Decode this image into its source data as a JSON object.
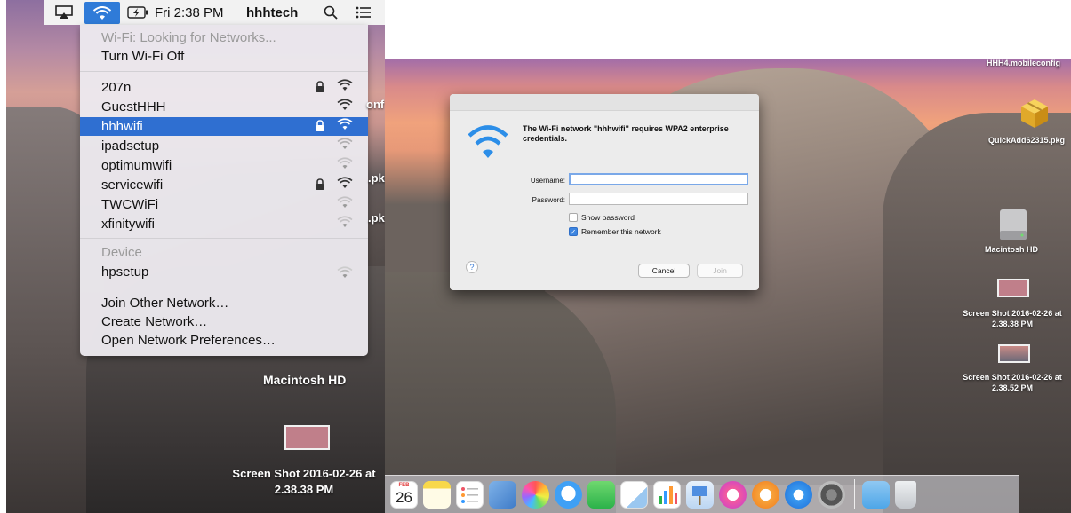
{
  "menubar": {
    "clock": "Fri 2:38 PM",
    "user": "hhhtech"
  },
  "wifi_menu": {
    "status": "Wi-Fi: Looking for Networks...",
    "toggle": "Turn Wi-Fi Off",
    "networks": [
      {
        "name": "207n",
        "locked": true,
        "selected": false
      },
      {
        "name": "GuestHHH",
        "locked": false,
        "selected": false
      },
      {
        "name": "hhhwifi",
        "locked": true,
        "selected": true
      },
      {
        "name": "ipadsetup",
        "locked": false,
        "selected": false
      },
      {
        "name": "optimumwifi",
        "locked": false,
        "selected": false
      },
      {
        "name": "servicewifi",
        "locked": true,
        "selected": false
      },
      {
        "name": "TWCWiFi",
        "locked": false,
        "selected": false
      },
      {
        "name": "xfinitywifi",
        "locked": false,
        "selected": false
      }
    ],
    "device_header": "Device",
    "device_name": "hpsetup",
    "actions": [
      "Join Other Network…",
      "Create Network…",
      "Open Network Preferences…"
    ]
  },
  "left_desktop": {
    "drive_label": "Macintosh HD",
    "screenshot_label_1": "Screen Shot 2016-02-26 at",
    "screenshot_label_2": "2.38.38 PM",
    "fragment_1": "onf",
    "fragment_2": ".pk",
    "fragment_3": ".pk"
  },
  "dialog": {
    "message": "The Wi-Fi network \"hhhwifi\" requires WPA2 enterprise credentials.",
    "username_label": "Username:",
    "password_label": "Password:",
    "username_value": "",
    "password_value": "",
    "show_password": {
      "label": "Show password",
      "checked": false
    },
    "remember": {
      "label": "Remember this network",
      "checked": true
    },
    "help": "?",
    "cancel": "Cancel",
    "join": "Join"
  },
  "right_desktop": {
    "top_right_text": "HHH4.mobileconfig",
    "pkg_label": "QuickAdd62315.pkg",
    "drive_label": "Macintosh HD",
    "shot1_line1": "Screen Shot 2016-02-26 at",
    "shot1_line2": "2.38.38 PM",
    "shot2_line1": "Screen Shot 2016-02-26 at",
    "shot2_line2": "2.38.52 PM"
  },
  "dock": {
    "calendar_month": "FEB",
    "calendar_day": "26",
    "icons": [
      "calendar-icon",
      "notes-icon",
      "reminders-icon",
      "preview-icon",
      "photos-icon",
      "messages-icon",
      "facetime-icon",
      "textedit-icon",
      "numbers-icon",
      "keynote-icon",
      "itunes-icon",
      "ibooks-icon",
      "app-store-icon",
      "system-preferences-icon",
      "downloads-folder-icon",
      "trash-icon"
    ]
  },
  "colors": {
    "selection": "#2f6fd1",
    "accent": "#3d85e0",
    "dialog_bg": "#ececec"
  }
}
